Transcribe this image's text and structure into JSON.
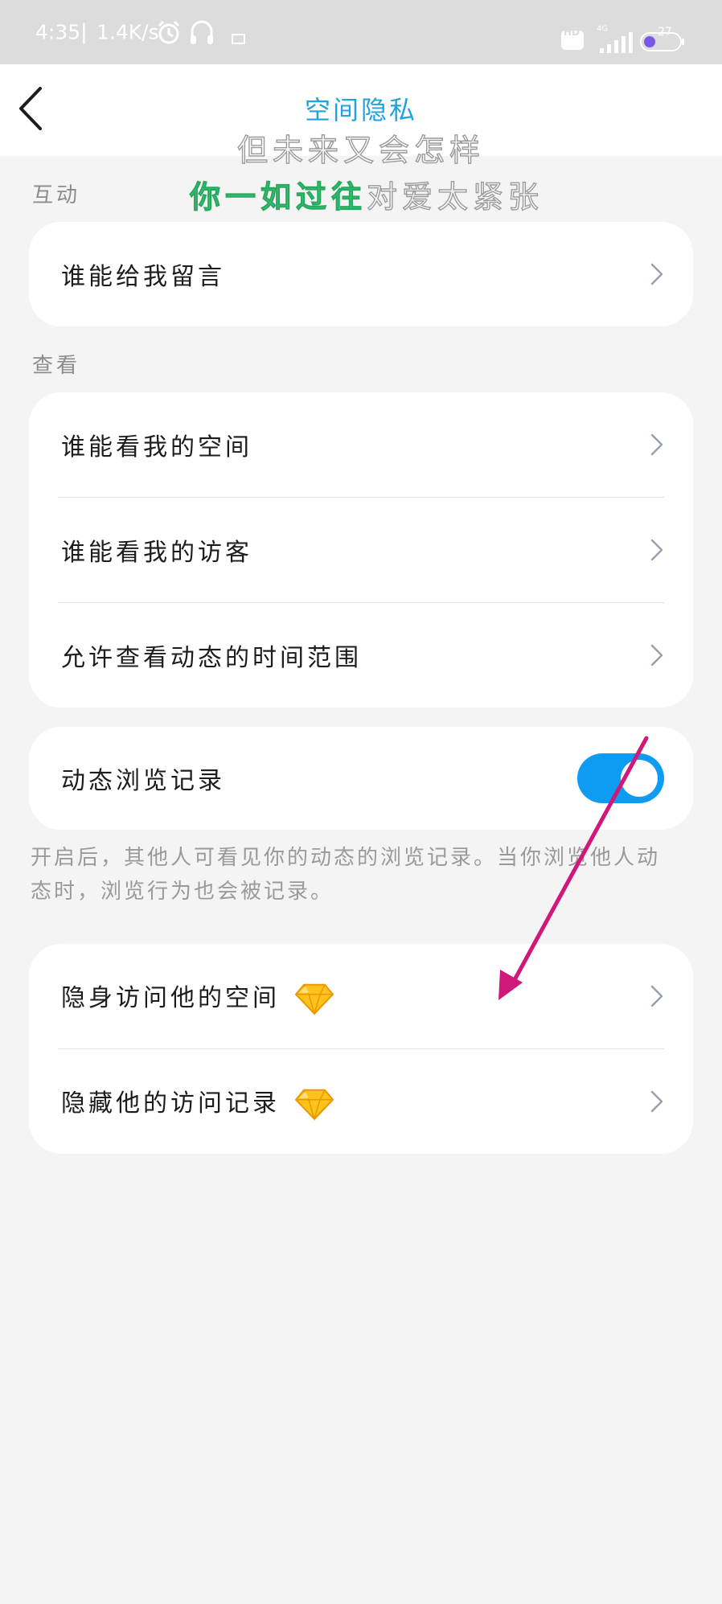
{
  "status_bar": {
    "time": "4:35",
    "separator": "|",
    "speed": "1.4K/s",
    "network": "4G",
    "hd": "HD",
    "battery": "27",
    "icons": [
      "alarm-icon",
      "headset-icon",
      "notification-icon",
      "hd-icon",
      "signal-icon",
      "battery-icon"
    ]
  },
  "header": {
    "title": "空间隐私",
    "back_icon": "chevron-left-icon"
  },
  "lyrics": {
    "line1": "但未来又会怎样",
    "line2_highlight": "你一如过往",
    "line2_rest": "对爱太紧张"
  },
  "sections": {
    "interaction": {
      "label": "互动",
      "items": [
        {
          "label": "谁能给我留言"
        }
      ]
    },
    "view": {
      "label": "查看",
      "items": [
        {
          "label": "谁能看我的空间"
        },
        {
          "label": "谁能看我的访客"
        },
        {
          "label": "允许查看动态的时间范围"
        }
      ]
    },
    "browse": {
      "label": "动态浏览记录",
      "toggle_on": true,
      "note": "开启后，其他人可看见你的动态的浏览记录。当你浏览他人动态时，浏览行为也会被记录。"
    },
    "vip": {
      "items": [
        {
          "label": "隐身访问他的空间",
          "icon": "diamond-icon"
        },
        {
          "label": "隐藏他的访问记录",
          "icon": "diamond-icon"
        }
      ]
    }
  },
  "colors": {
    "accent": "#0e9cf2",
    "title": "#1fa3dc",
    "arrow": "#d0177a",
    "background": "#f4f4f4"
  }
}
